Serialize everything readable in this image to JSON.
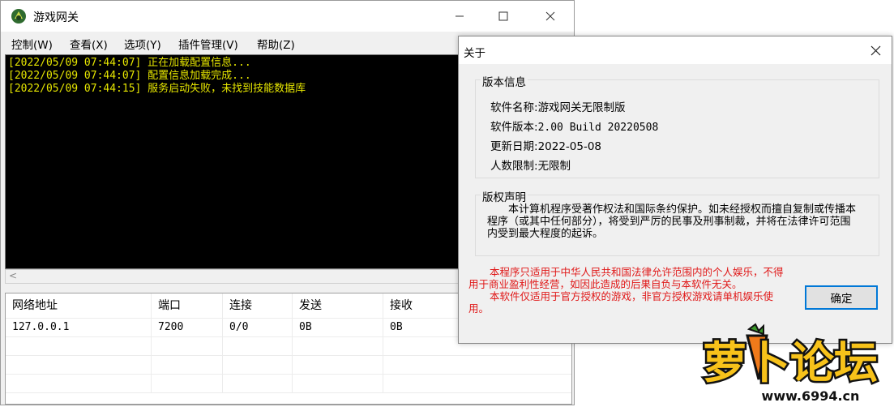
{
  "main_window": {
    "title": "游戏网关",
    "menu": [
      "控制(W)",
      "查看(X)",
      "选项(Y)",
      "插件管理(V)",
      "帮助(Z)"
    ],
    "console_lines": [
      "[2022/05/09 07:44:07] 正在加载配置信息...",
      "[2022/05/09 07:44:07] 配置信息加载完成...",
      "[2022/05/09 07:44:15] 服务启动失败，未找到技能数据库"
    ],
    "table": {
      "columns": [
        "网络地址",
        "端口",
        "连接",
        "发送",
        "接收"
      ],
      "rows": [
        [
          "127.0.0.1",
          "7200",
          "0/0",
          "0B",
          "0B"
        ]
      ]
    }
  },
  "about_dialog": {
    "title": "关于",
    "version_group": {
      "legend": "版本信息",
      "name_label": "软件名称:",
      "name_value": "游戏网关无限制版",
      "version_label": "软件版本:",
      "version_value": "2.00 Build 20220508",
      "date_label": "更新日期:",
      "date_value": "2022-05-08",
      "limit_label": "人数限制:",
      "limit_value": "无限制"
    },
    "copyright_group": {
      "legend": "版权声明",
      "text": "本计算机程序受著作权法和国际条约保护。如未经授权而擅自复制或传播本程序（或其中任何部分），将受到严厉的民事及刑事制裁，并将在法律许可范围内受到最大程度的起诉。"
    },
    "notice": [
      "本程序只适用于中华人民共和国法律允许范围内的个人娱乐，不得用于商业盈利性经营，如因此造成的后果自负与本软件无关。",
      "本软件仅适用于官方授权的游戏，非官方授权游戏请单机娱乐使用。"
    ],
    "ok_label": "确定"
  },
  "watermark": {
    "text": "萝卜论坛",
    "url": "www.6994.cn"
  },
  "colors": {
    "console_bg": "#000000",
    "console_text": "#e6e600",
    "notice_text": "#e01818",
    "default_button_border": "#0078d7",
    "watermark_fill": "#f7c21a",
    "watermark_outline": "#111111"
  }
}
